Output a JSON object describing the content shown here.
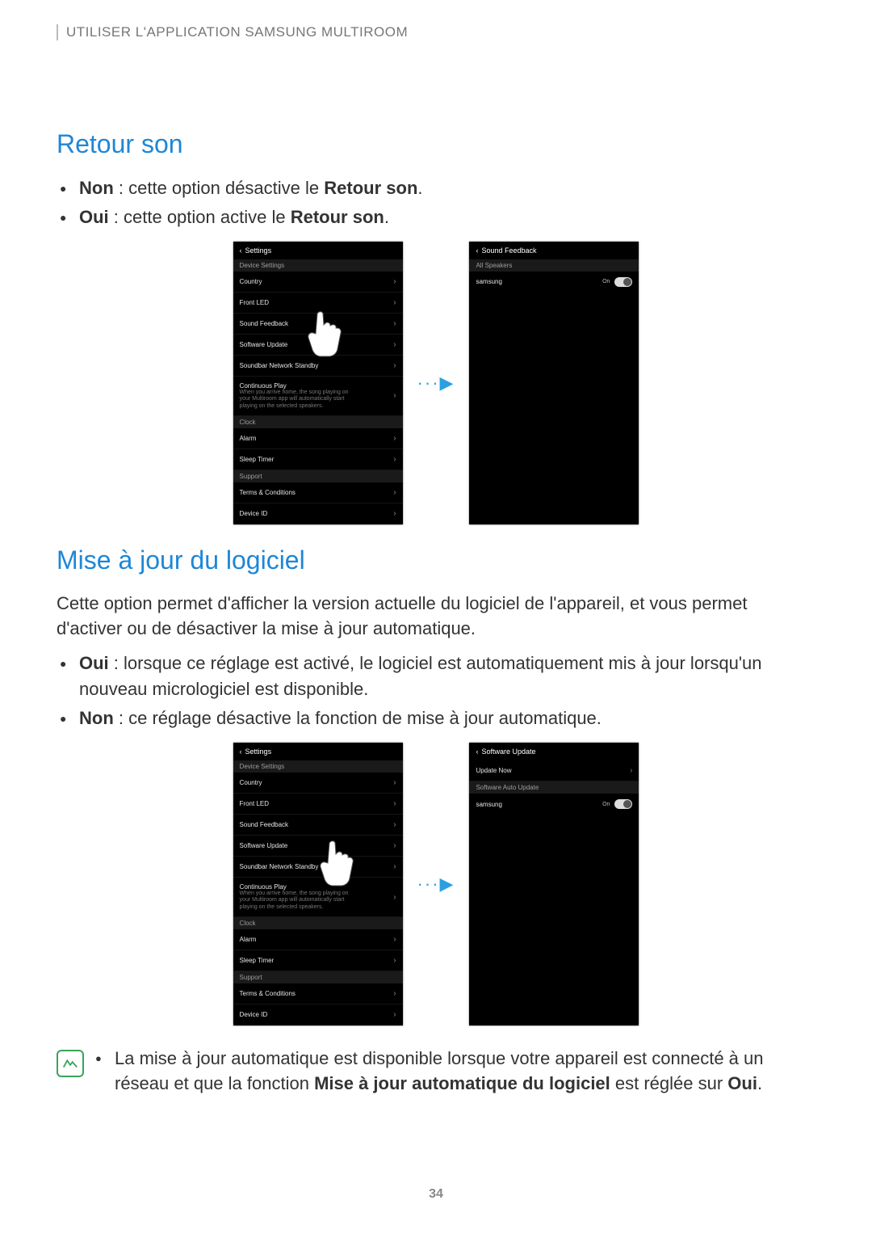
{
  "header": "UTILISER L'APPLICATION SAMSUNG MULTIROOM",
  "section1": {
    "title": "Retour son",
    "items": [
      {
        "bold": "Non",
        "rest": " : cette option désactive le ",
        "bold2": "Retour son",
        "tail": "."
      },
      {
        "bold": "Oui",
        "rest": " : cette option active le ",
        "bold2": "Retour son",
        "tail": "."
      }
    ]
  },
  "phone_settings": {
    "back": "Settings",
    "sec_device": "Device Settings",
    "country": "Country",
    "front_led": "Front LED",
    "sound_feedback": "Sound Feedback",
    "software_update": "Software Update",
    "soundbar_network": "Soundbar Network Standby",
    "continuous_play": "Continuous Play",
    "continuous_play_sub": "When you arrive home, the song playing on your Multiroom app will automatically start playing on the selected speakers.",
    "sec_clock": "Clock",
    "alarm": "Alarm",
    "sleep_timer": "Sleep Timer",
    "sec_support": "Support",
    "terms": "Terms & Conditions",
    "device_id": "Device ID"
  },
  "phone_sound_feedback": {
    "back": "Sound Feedback",
    "sec_all": "All Speakers",
    "row_speaker": "samsung",
    "toggle": "On"
  },
  "section2": {
    "title": "Mise à jour du logiciel",
    "intro": "Cette option permet d'afficher la version actuelle du logiciel de l'appareil, et vous permet d'activer ou de désactiver la mise à jour automatique.",
    "items": [
      {
        "bold": "Oui",
        "rest": " : lorsque ce réglage est activé, le logiciel est automatiquement mis à jour lorsqu'un nouveau micrologiciel est disponible."
      },
      {
        "bold": "Non",
        "rest": " : ce réglage désactive la fonction de mise à jour automatique."
      }
    ]
  },
  "phone_software_update": {
    "back": "Software Update",
    "update_now": "Update Now",
    "sec_auto": "Software Auto Update",
    "row_speaker": "samsung",
    "toggle": "On"
  },
  "note": {
    "pre": "La mise à jour automatique est disponible lorsque votre appareil est connecté à un réseau et que la fonction ",
    "bold1": "Mise à jour automatique du logiciel",
    "mid": " est réglée sur ",
    "bold2": "Oui",
    "tail": "."
  },
  "page_number": "34"
}
